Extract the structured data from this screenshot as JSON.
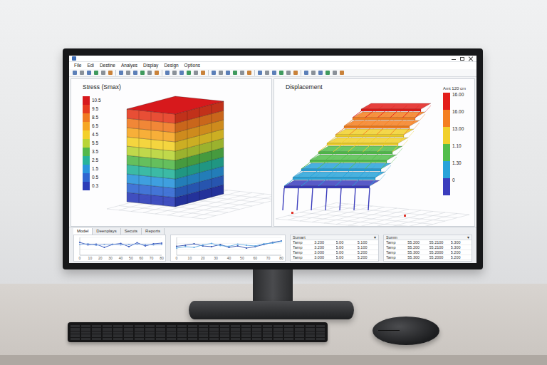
{
  "menu": [
    {
      "label": "File"
    },
    {
      "label": "Edi"
    },
    {
      "label": "Destine"
    },
    {
      "label": "Analyes"
    },
    {
      "label": "Display"
    },
    {
      "label": "Design"
    },
    {
      "label": "Options"
    }
  ],
  "stress_view": {
    "title": "Stress (Smax)",
    "legend": [
      {
        "label": "10.5",
        "color": "#d7191c"
      },
      {
        "label": "9.5",
        "color": "#e63b1f"
      },
      {
        "label": "8.5",
        "color": "#f07a21"
      },
      {
        "label": "6.5",
        "color": "#f6a623"
      },
      {
        "label": "4.5",
        "color": "#f3d02a"
      },
      {
        "label": "5.5",
        "color": "#b9d437"
      },
      {
        "label": "3.5",
        "color": "#54b84b"
      },
      {
        "label": "2.5",
        "color": "#27b39b"
      },
      {
        "label": "1.5",
        "color": "#2a95dc"
      },
      {
        "label": "0.5",
        "color": "#2f66d1"
      },
      {
        "label": "0.3",
        "color": "#2b3cb8"
      }
    ]
  },
  "displacement_view": {
    "title": "Displacement",
    "unit": "Amt 120 cm",
    "legend": [
      {
        "label": "16.00",
        "color": "#e31e1b"
      },
      {
        "label": "16.00",
        "color": "#f47f20"
      },
      {
        "label": "13.00",
        "color": "#f1d02b"
      },
      {
        "label": "1.10",
        "color": "#52be4b"
      },
      {
        "label": "1.30",
        "color": "#28a3d9"
      },
      {
        "label": "0",
        "color": "#3b3dbd"
      }
    ]
  },
  "bottom_tabs": [
    {
      "label": "Model",
      "selected": true
    },
    {
      "label": "Deenplays",
      "selected": false
    },
    {
      "label": "Secuts",
      "selected": false
    },
    {
      "label": "Reports",
      "selected": false
    }
  ],
  "charts": [
    {
      "x_ticks": [
        "0",
        "10",
        "20",
        "30",
        "40",
        "50",
        "60",
        "70",
        "80"
      ],
      "series": [
        {
          "color": "#3a5bbf",
          "values": [
            3.6,
            2.9,
            3.1,
            2.2,
            3.0,
            3.3,
            2.4,
            3.5,
            2.6,
            3.2,
            3.4
          ]
        },
        {
          "color": "#7fa6de",
          "values": [
            3.0,
            3.2,
            2.8,
            3.0,
            3.1,
            2.9,
            3.0,
            3.1,
            3.0,
            2.9,
            3.0
          ]
        }
      ]
    },
    {
      "x_ticks": [
        "0",
        "10",
        "20",
        "30",
        "40",
        "50",
        "60",
        "70",
        "80"
      ],
      "series": [
        {
          "color": "#2f4fae",
          "values": [
            2.5,
            2.8,
            3.2,
            2.6,
            2.4,
            3.0,
            2.2,
            2.6,
            2.0,
            2.4,
            3.0,
            3.6,
            4.0
          ]
        },
        {
          "color": "#5fa8e0",
          "values": [
            2.0,
            2.4,
            2.2,
            2.9,
            3.3,
            2.7,
            2.5,
            3.1,
            2.8,
            2.6,
            3.2,
            3.4,
            3.9
          ]
        }
      ]
    }
  ],
  "tables": [
    {
      "title": "Sumart",
      "caret": "▾",
      "rows": [
        [
          "Tamp",
          "3.200",
          "5.00",
          "5.100"
        ],
        [
          "Tamp",
          "3.200",
          "5.00",
          "5.100"
        ],
        [
          "Tamp",
          "3.000",
          "5.00",
          "5.200"
        ],
        [
          "Tamp",
          "3.000",
          "5.00",
          "5.200"
        ]
      ]
    },
    {
      "title": "Summ",
      "caret": "▾",
      "rows": [
        [
          "Tamp",
          "55.200",
          "55.2100",
          "5.300"
        ],
        [
          "Tamp",
          "55.200",
          "55.2100",
          "5.300"
        ],
        [
          "Tamp",
          "55.300",
          "55.2000",
          "5.200"
        ],
        [
          "Tamp",
          "55.300",
          "55.2000",
          "5.200"
        ]
      ]
    }
  ]
}
